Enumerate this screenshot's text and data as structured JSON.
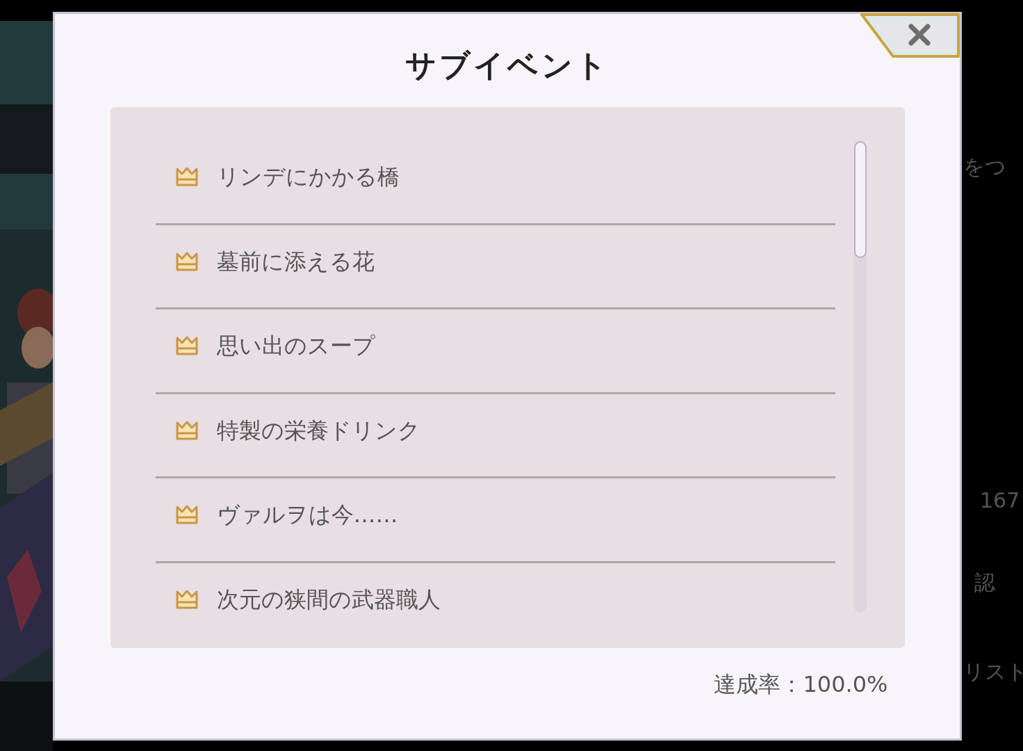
{
  "background": {
    "right_texts": [
      "をつ",
      "167",
      "認",
      "リスト"
    ]
  },
  "dialog": {
    "title": "サブイベント",
    "items": [
      {
        "label": "リンデにかかる橋",
        "completed": true
      },
      {
        "label": "墓前に添える花",
        "completed": true
      },
      {
        "label": "思い出のスープ",
        "completed": true
      },
      {
        "label": "特製の栄養ドリンク",
        "completed": true
      },
      {
        "label": "ヴァルヲは今……",
        "completed": true
      },
      {
        "label": "次元の狭間の武器職人",
        "completed": true
      }
    ],
    "completion": "達成率：100.0%"
  }
}
